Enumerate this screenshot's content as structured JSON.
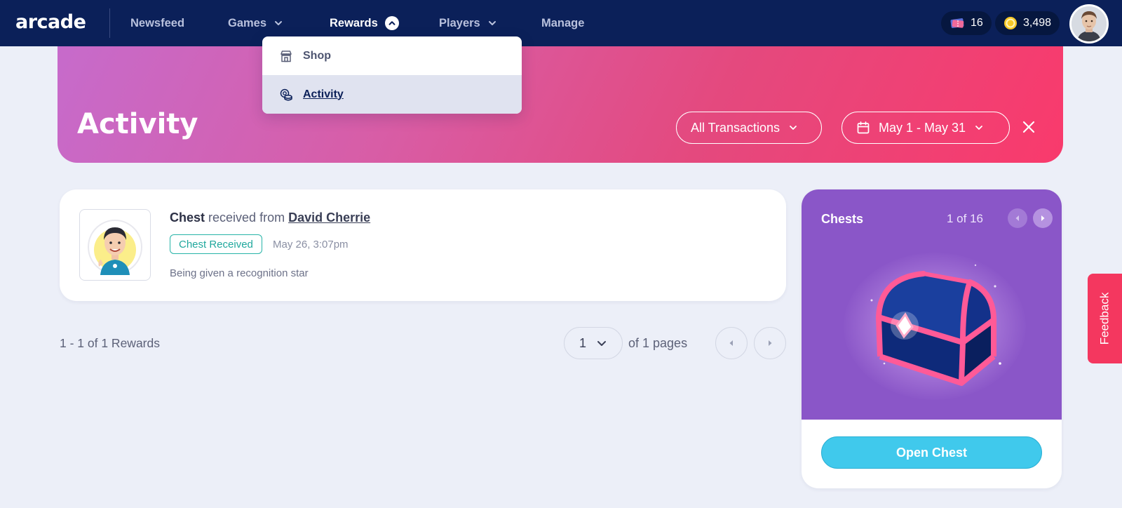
{
  "nav": {
    "logo": "arcade",
    "items": [
      {
        "label": "Newsfeed"
      },
      {
        "label": "Games"
      },
      {
        "label": "Rewards"
      },
      {
        "label": "Players"
      },
      {
        "label": "Manage"
      }
    ],
    "tickets": "16",
    "coins": "3,498"
  },
  "dropdown": {
    "items": [
      {
        "label": "Shop",
        "icon": "store-icon"
      },
      {
        "label": "Activity",
        "icon": "coins-icon",
        "selected": true
      }
    ]
  },
  "hero": {
    "title": "Activity",
    "filter_label": "All Transactions",
    "date_range": "May 1 - May 31"
  },
  "activity": {
    "item_type": "Chest",
    "received_from_text": "received from",
    "sender": "David Cherrie",
    "tag": "Chest Received",
    "date": "May 26, 3:07pm",
    "description": "Being given a recognition star"
  },
  "pagination": {
    "summary": "1 - 1 of 1 Rewards",
    "current_page": "1",
    "of_pages": "of 1 pages"
  },
  "chests": {
    "title": "Chests",
    "counter": "1 of 16",
    "open_label": "Open Chest"
  },
  "feedback": {
    "label": "Feedback"
  },
  "colors": {
    "nav_bg": "#0b2059",
    "hero_start": "#c66bcc",
    "hero_end": "#f93a6c",
    "chest_bg": "#8a56c8",
    "open_button": "#40c9ec",
    "tag": "#20a89d",
    "feedback": "#f4375f"
  }
}
